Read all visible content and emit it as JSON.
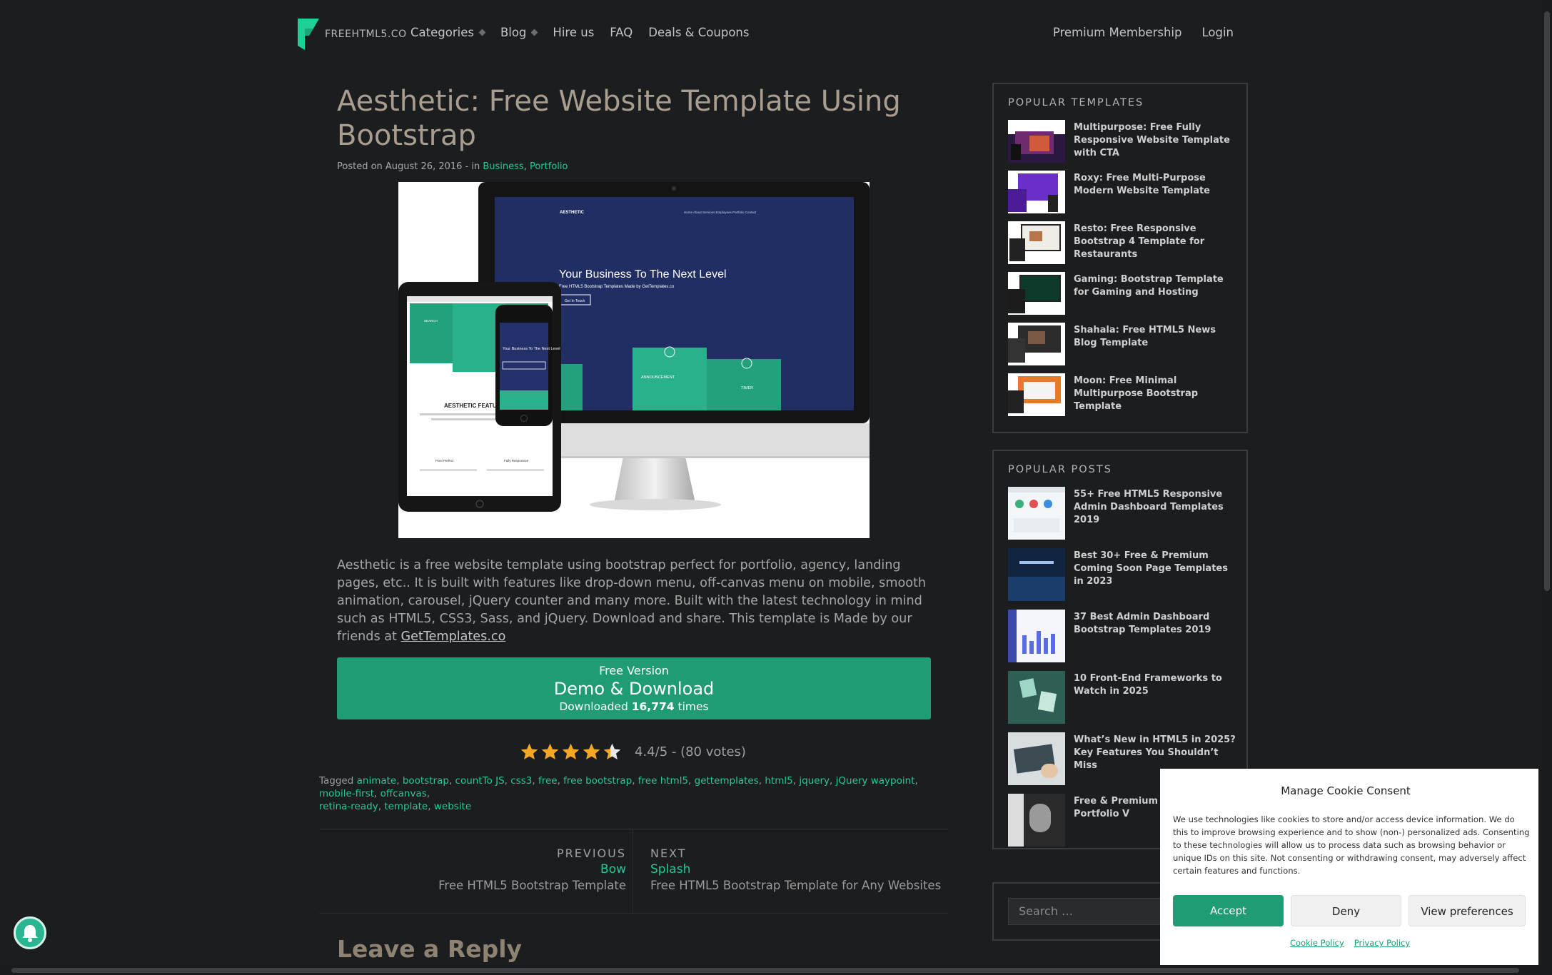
{
  "nav": {
    "logo_text": "FREEHTML5.CO",
    "items": [
      "Categories",
      "Blog",
      "Hire us",
      "FAQ",
      "Deals & Coupons"
    ],
    "right": [
      "Premium Membership",
      "Login"
    ]
  },
  "article": {
    "title_line1": "Aesthetic: Free Website Template Using",
    "title_line2": "Bootstrap",
    "posted_prefix": "Posted on August 26, 2016 - in",
    "categories": [
      "Business",
      "Portfolio"
    ],
    "hero": {
      "brand": "AESTHETIC",
      "headline": "Your Business To The Next Level",
      "subline": "Free HTML5 Bootstrap Templates Made by GetTemplates.co",
      "cta": "Get In Touch",
      "features_heading": "AESTHETIC FEATURES",
      "box_labels": [
        "SEARCH",
        "ANNOUNCEMENT",
        "TIMER"
      ],
      "phone_headline": "Your Business To The Next Level",
      "tablet_items": [
        "Pixel Perfect",
        "Fully Responsive"
      ]
    },
    "description": "Aesthetic is a free website template using bootstrap perfect for portfolio, agency, landing pages, etc.. It is built with features like drop-down menu, off-canvas menu on mobile, smooth animation, carousel, jQuery counter and many more. Built with the latest technology in mind such as HTML5, CSS3, Sass, and jQuery. Download and share. This template is Made by our friends at",
    "description_link": "GetTemplates.co",
    "download": {
      "label_top": "Free Version",
      "label_main": "Demo & Download",
      "count_prefix": "Downloaded",
      "count": "16,774",
      "count_suffix": "times"
    },
    "rating": {
      "stars": 4.4,
      "text": "4.4/5 - (80 votes)"
    },
    "tags_prefix": "Tagged",
    "tags": [
      "animate",
      "bootstrap",
      "countTo JS",
      "css3",
      "free",
      "free bootstrap",
      "free html5",
      "gettemplates",
      "html5",
      "jquery",
      "jQuery waypoint",
      "mobile-first",
      "offcanvas",
      "retina-ready",
      "template",
      "website"
    ],
    "prev": {
      "kicker": "PREVIOUS",
      "title": "Bow",
      "sub": "Free HTML5 Bootstrap Template"
    },
    "next": {
      "kicker": "NEXT",
      "title": "Splash",
      "sub": "Free HTML5 Bootstrap Template for Any Websites"
    },
    "reply_heading": "Leave a Reply"
  },
  "sidebar": {
    "templates_title": "POPULAR TEMPLATES",
    "templates": [
      "Multipurpose: Free Fully Responsive Website Template with CTA",
      "Roxy: Free Multi-Purpose Modern Website Template",
      "Resto: Free Responsive Bootstrap 4 Template for Restaurants",
      "Gaming: Bootstrap Template for Gaming and Hosting",
      "Shahala: Free HTML5 News Blog Template",
      "Moon: Free Minimal Multipurpose Bootstrap Template"
    ],
    "posts_title": "POPULAR POSTS",
    "posts": [
      "55+ Free HTML5 Responsive Admin Dashboard Templates 2019",
      "Best 30+ Free & Premium Coming Soon Page Templates in 2023",
      "37 Best Admin Dashboard Bootstrap Templates 2019",
      "10 Front-End Frameworks to Watch in 2025",
      "What’s New in HTML5 in 2025? Key Features You Shouldn’t Miss",
      "Free & Premium Ph Creative Portfolio V"
    ],
    "search_placeholder": "Search …"
  },
  "cookie": {
    "title": "Manage Cookie Consent",
    "text": "We use technologies like cookies to store and/or access device information. We do this to improve browsing experience and to show (non-) personalized ads. Consenting to these technologies will allow us to process data such as browsing behavior or unique IDs on this site. Not consenting or withdrawing consent, may adversely affect certain features and functions.",
    "accept": "Accept",
    "deny": "Deny",
    "preferences": "View preferences",
    "links": [
      "Cookie Policy",
      "Privacy Policy"
    ]
  },
  "colors": {
    "accent": "#1f9c76",
    "link": "#26c89a",
    "background": "#1c1d1f",
    "title": "#a89e8f"
  }
}
